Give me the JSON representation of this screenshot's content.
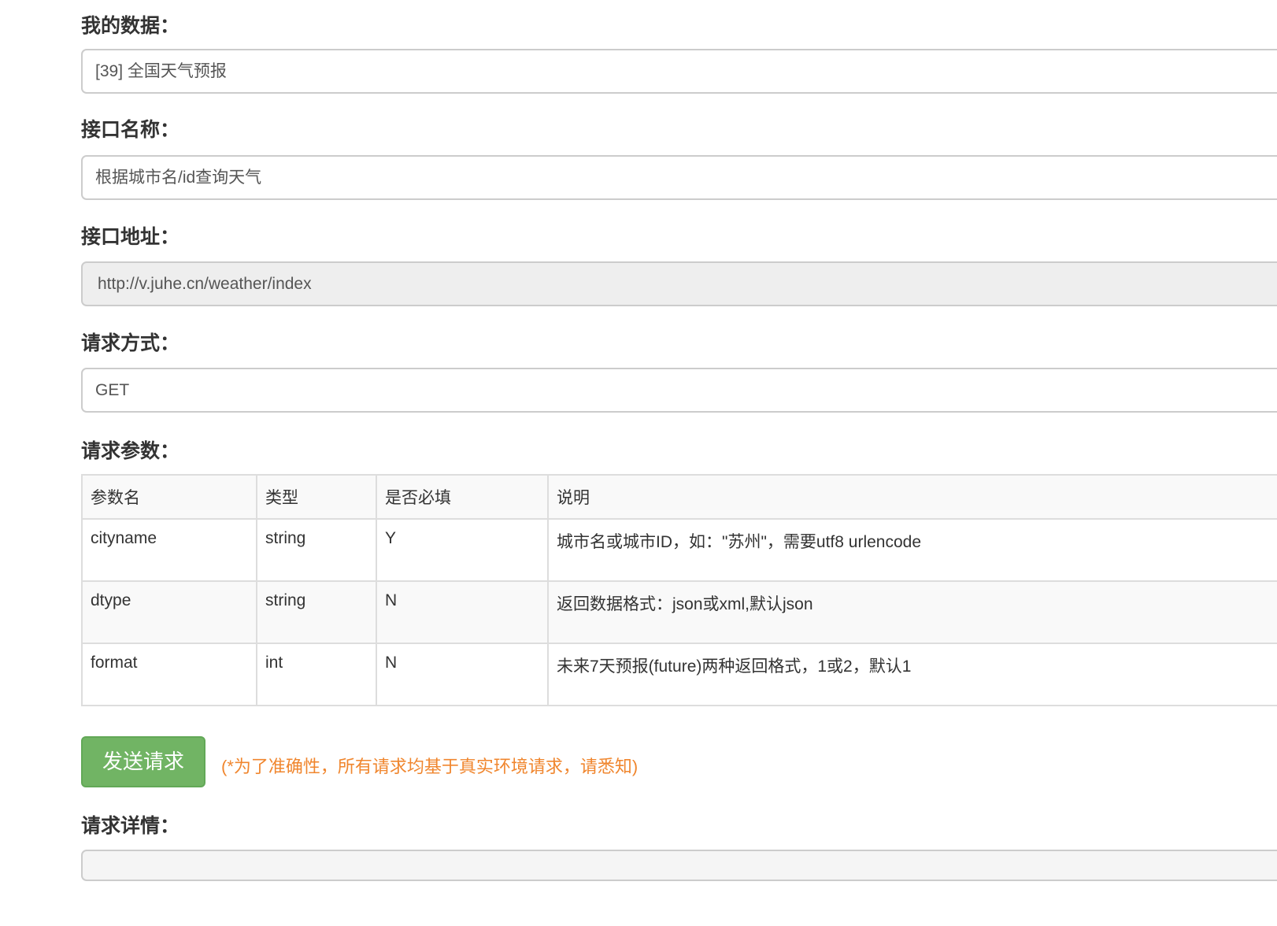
{
  "fields": [
    {
      "label": "我的数据：",
      "value": "[39] 全国天气预报"
    },
    {
      "label": "接口名称：",
      "value": "根据城市名/id查询天气"
    },
    {
      "label": "接口地址：",
      "value": "http://v.juhe.cn/weather/index"
    },
    {
      "label": "请求方式：",
      "value": "GET"
    }
  ],
  "params": {
    "label": "请求参数：",
    "headers": [
      "参数名",
      "类型",
      "是否必填",
      "说明"
    ],
    "rows": [
      [
        "cityname",
        "string",
        "Y",
        "城市名或城市ID，如：\"苏州\"，需要utf8 urlencode"
      ],
      [
        "dtype",
        "string",
        "N",
        "返回数据格式：json或xml,默认json"
      ],
      [
        "format",
        "int",
        "N",
        "未来7天预报(future)两种返回格式，1或2，默认1"
      ]
    ]
  },
  "send_button": "发送请求",
  "notice": "(*为了准确性，所有请求均基于真实环境请求，请悉知)",
  "detail_label": "请求详情：",
  "colors": {
    "button": "#71b464",
    "notice": "#f0862e"
  }
}
